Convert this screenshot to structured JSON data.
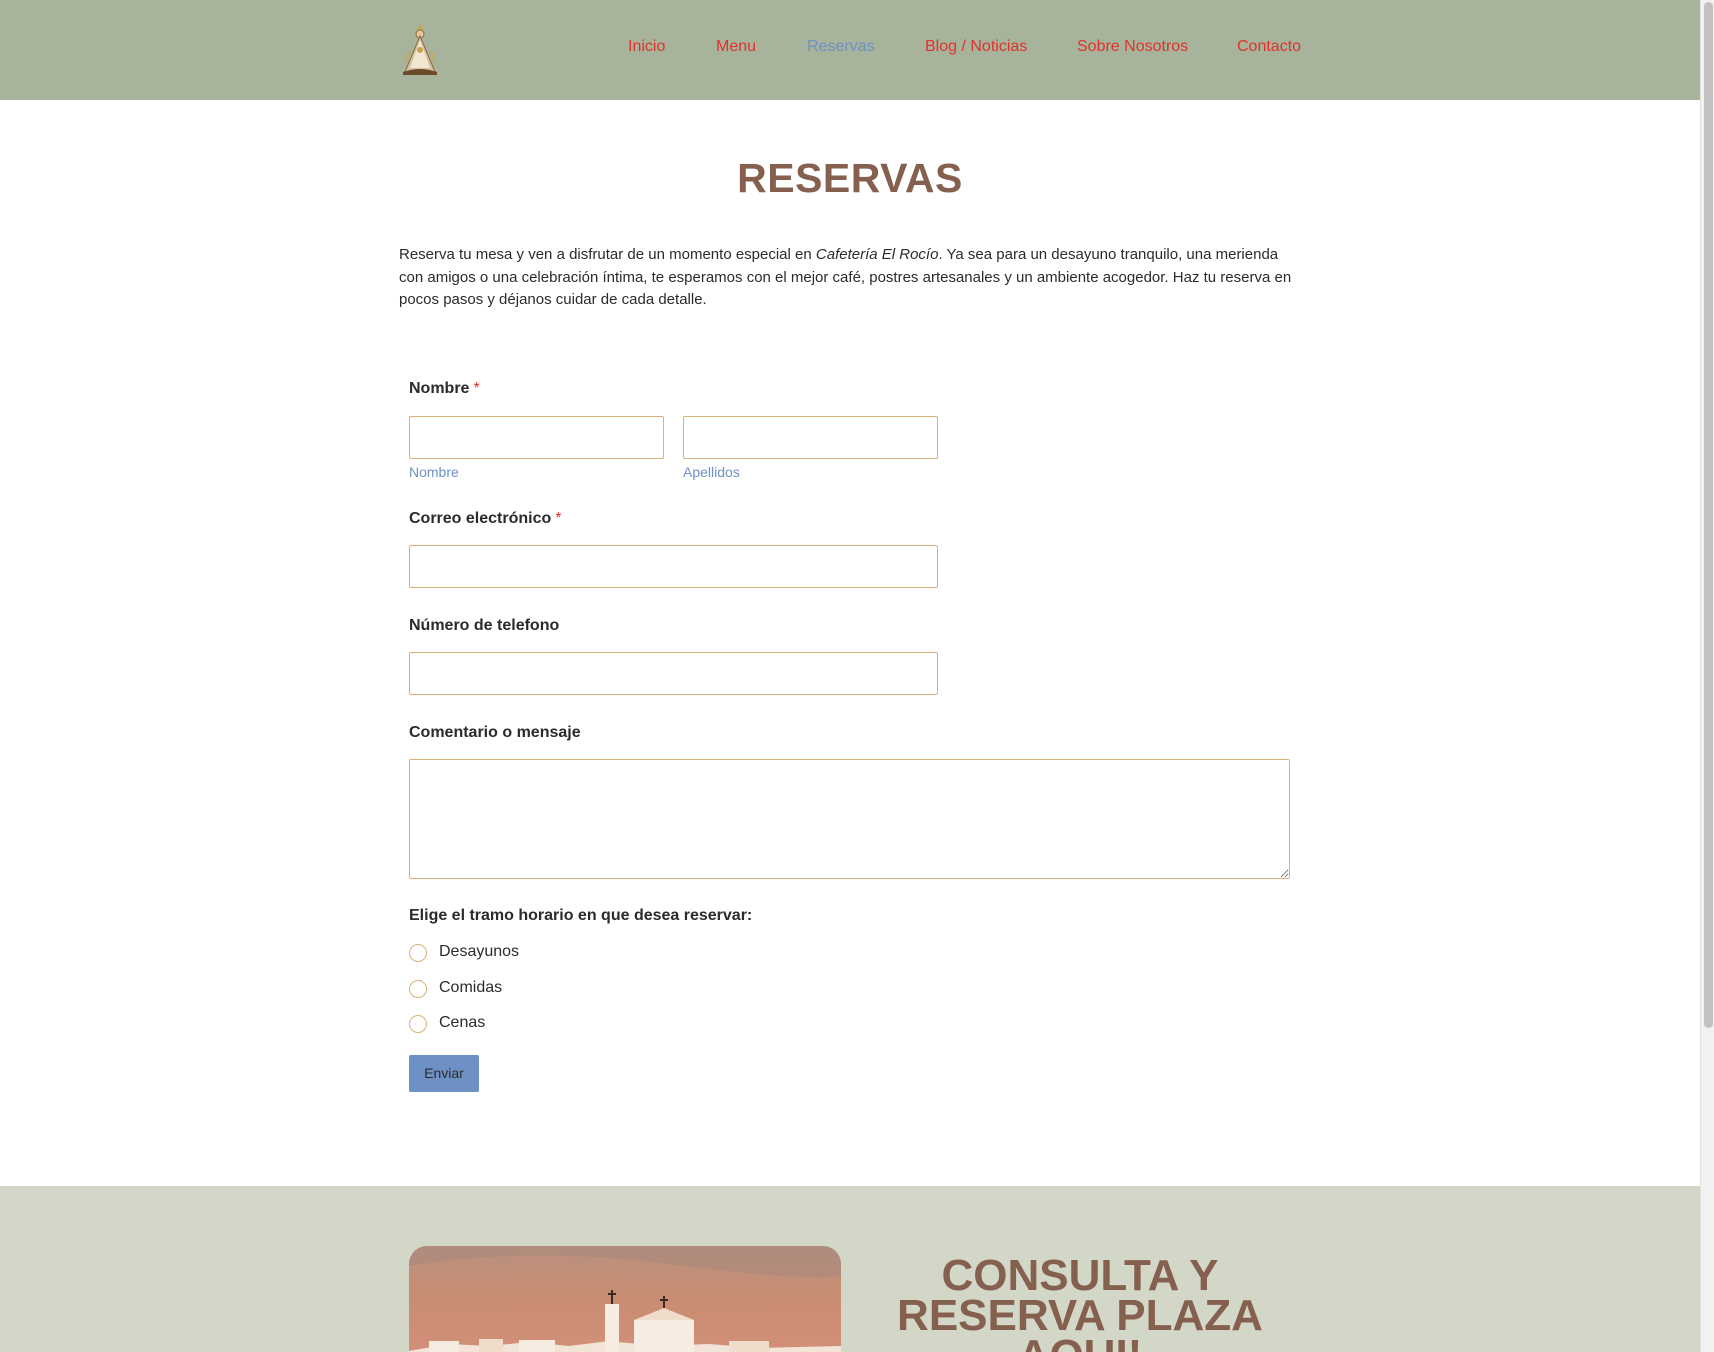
{
  "header": {
    "logo_alt": "Virgen del Rocío emblem",
    "nav": [
      {
        "label": "Inicio",
        "active": false
      },
      {
        "label": "Menu",
        "active": false
      },
      {
        "label": "Reservas",
        "active": true
      },
      {
        "label": "Blog / Noticias",
        "active": false
      },
      {
        "label": "Sobre Nosotros",
        "active": false
      },
      {
        "label": "Contacto",
        "active": false
      }
    ]
  },
  "page": {
    "title": "RESERVAS",
    "intro_before": "Reserva tu mesa y ven a disfrutar de un momento especial en ",
    "intro_emphasis": "Cafetería El Rocío",
    "intro_after": ". Ya sea para un desayuno tranquilo, una merienda con amigos o una celebración íntima, te esperamos con el mejor café, postres artesanales y un ambiente acogedor. Haz tu reserva en pocos pasos y déjanos cuidar de cada detalle."
  },
  "form": {
    "name_label": "Nombre",
    "required_mark": "*",
    "first_name_value": "",
    "first_name_sublabel": "Nombre",
    "last_name_value": "",
    "last_name_sublabel": "Apellidos",
    "email_label": "Correo electrónico",
    "email_value": "",
    "phone_label": "Número de telefono",
    "phone_value": "",
    "comment_label": "Comentario o mensaje",
    "comment_value": "",
    "slot_label": "Elige el tramo horario en que desea reservar:",
    "slot_options": [
      "Desayunos",
      "Comidas",
      "Cenas"
    ],
    "submit_label": "Enviar"
  },
  "promo": {
    "heading": "CONSULTA Y RESERVA PLAZA AQUI!"
  },
  "colors": {
    "header_bg": "#a7b39b",
    "nav_link": "#e0322d",
    "nav_active": "#6d91c4",
    "title": "#86604f",
    "field_border": "#d8b27a",
    "button_bg": "#6d91c4",
    "footer_bg": "#d3d7c8"
  }
}
